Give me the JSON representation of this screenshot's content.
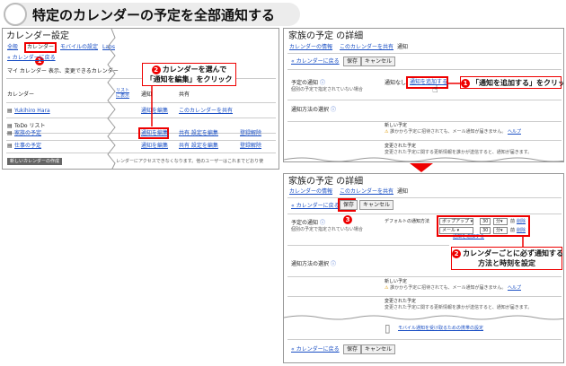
{
  "title": "特定のカレンダーの予定を全部通知する",
  "left": {
    "heading": "カレンダー設定",
    "tabs": [
      "全般",
      "カレンダー",
      "モバイルの設定",
      "Labs"
    ],
    "back": "« カレンダーに戻る",
    "my_cal": "マイ カレンダー 表示、変更できるカレンダー",
    "col_cal": "カレンダー",
    "col_show1": "リストに表示",
    "col_show2": "通知",
    "col_notify": "通知",
    "col_share": "共有",
    "rows": [
      {
        "name": "Yukihiro Hara",
        "notify": "通知を編集",
        "share": "このカレンダーを共有",
        "delete": ""
      },
      {
        "name": "ToDo リスト",
        "notify": "",
        "share": "",
        "delete": ""
      },
      {
        "name": "家族の予定",
        "notify": "通知を編集",
        "share": "共有 設定を編集",
        "delete": "登録解除"
      },
      {
        "name": "仕事の予定",
        "notify": "通知を編集",
        "share": "共有 設定を編集",
        "delete": "登録解除"
      }
    ],
    "create_btn": "新しいカレンダーの作成",
    "footer": "レンダーにアクセスできなくなります。他のユーザーはこれまでどおり使",
    "callout1": "カレンダーを選んで",
    "callout2": "「通知を編集」をクリック",
    "num1": "1",
    "num2": "2"
  },
  "tr": {
    "heading": "家族の予定 の詳細",
    "tabs": [
      "カレンダーの情報",
      "このカレンダーを共有",
      "通知"
    ],
    "back": "« カレンダーに戻る",
    "save": "保存",
    "cancel": "キャンセル",
    "label1": "予定の通知",
    "desc1": "個別の予定で指定されていない場合",
    "none": "通知なし",
    "add_link": "通知を追加する",
    "callout": "「通知を追加する」をクリック",
    "num": "1",
    "method": "通知方法の選択",
    "new_title": "新しい予定",
    "new_desc": "誰かから予定に招待されても、メール通知が届きません。",
    "help": "ヘルプ",
    "chg_title": "変更された予定",
    "chg_desc": "変更された予定に関する更新情報を誰かが送信すると、通知が届きます。"
  },
  "br": {
    "heading": "家族の予定 の詳細",
    "tabs": [
      "カレンダーの情報",
      "このカレンダーを共有",
      "通知"
    ],
    "back": "« カレンダーに戻る",
    "save": "保存",
    "cancel": "キャンセル",
    "num3": "3",
    "label1": "予定の通知",
    "desc1": "個別の予定で指定されていない場合",
    "default": "デフォルトの通知方法",
    "sel1": "ポップアップ",
    "sel2": "メール",
    "val1": "30",
    "val2": "30",
    "unit": "分",
    "before": "前",
    "del": "削除",
    "add_link": "通知を追加する",
    "callout1": "カレンダーごとに必ず通知する",
    "callout2": "方法と時刻を設定",
    "num2": "2",
    "method": "通知方法の選択",
    "new_title": "新しい予定",
    "new_desc": "誰かから予定に招待されても、メール通知が届きません。",
    "help": "ヘルプ",
    "chg_title": "変更された予定",
    "chg_desc": "変更された予定に関する更新情報を誰かが送信すると、通知が届きます。",
    "mobile": "モバイル通知を受け取るための携帯の設定",
    "save2": "保存",
    "cancel2": "キャンセル"
  }
}
